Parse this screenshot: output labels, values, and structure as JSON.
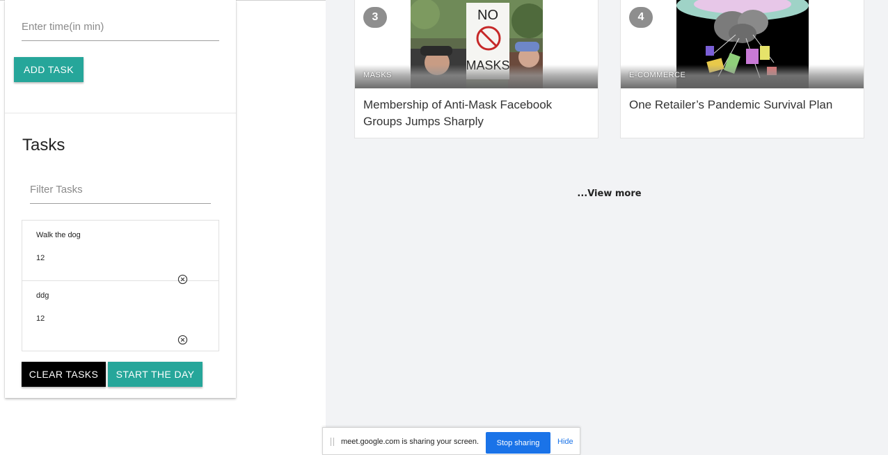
{
  "left_panel": {
    "time_input": {
      "placeholder": "Enter time(in min)",
      "value": ""
    },
    "add_task_label": "ADD TASK",
    "tasks_title": "Tasks",
    "filter_input": {
      "placeholder": "Filter Tasks",
      "value": ""
    },
    "tasks": [
      {
        "name": "Walk the dog",
        "time": "12"
      },
      {
        "name": "ddg",
        "time": "12"
      }
    ],
    "clear_tasks_label": "CLEAR TASKS",
    "start_day_label": "START THE DAY"
  },
  "articles": [
    {
      "rank": "3",
      "category": "MASKS",
      "headline": "Membership of Anti-Mask Facebook Groups Jumps Sharply",
      "sign_text_line1": "NO",
      "sign_text_line2": "MASKS"
    },
    {
      "rank": "4",
      "category": "E-COMMERCE",
      "headline": "One Retailer’s Pandemic Survival Plan"
    }
  ],
  "view_more_label": "...View more",
  "share_bar": {
    "message": "meet.google.com is sharing your screen.",
    "stop_label": "Stop sharing",
    "hide_label": "Hide"
  },
  "colors": {
    "teal_button": "#26a69a",
    "black_button": "#000000",
    "content_background": "#f2f3f5",
    "badge": "#8e8e8e",
    "google_blue": "#1a73e8"
  }
}
